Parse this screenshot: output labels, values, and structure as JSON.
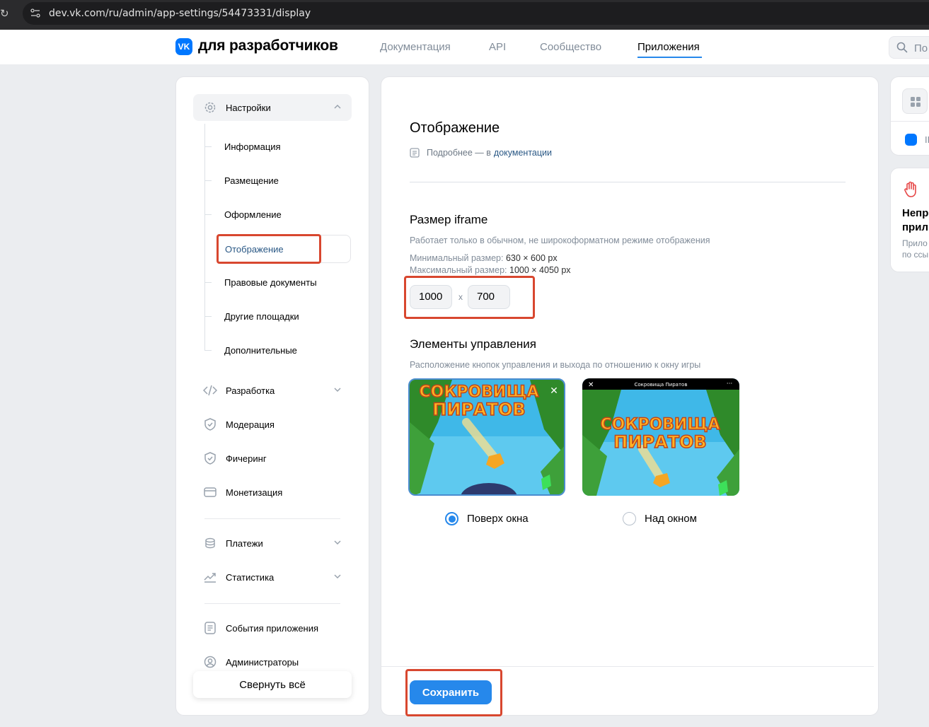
{
  "browser": {
    "url": "dev.vk.com/ru/admin/app-settings/54473331/display"
  },
  "header": {
    "logo_text": "VK",
    "brand": "для разработчиков",
    "nav": [
      "Документация",
      "API",
      "Сообщество",
      "Приложения"
    ],
    "active_nav": "Приложения",
    "search_placeholder": "По"
  },
  "sidebar": {
    "settings_label": "Настройки",
    "sub_items": [
      "Информация",
      "Размещение",
      "Оформление",
      "Отображение",
      "Правовые документы",
      "Другие площадки",
      "Дополнительные"
    ],
    "active_sub": "Отображение",
    "items": [
      "Разработка",
      "Модерация",
      "Фичеринг",
      "Монетизация",
      "Платежи",
      "Статистика",
      "События приложения",
      "Администраторы"
    ],
    "collapse_all": "Свернуть всё"
  },
  "main": {
    "title": "Отображение",
    "doc_prefix": "Подробнее — в",
    "doc_link": "документации",
    "iframe": {
      "title": "Размер iframe",
      "note": "Работает только в обычном, не широкоформатном режиме отображения",
      "min_label": "Минимальный размер:",
      "min_value": "630 × 600 px",
      "max_label": "Максимальный размер:",
      "max_value": "1000 × 4050 px",
      "width": "1000",
      "height": "700",
      "separator": "x"
    },
    "controls": {
      "title": "Элементы управления",
      "note": "Расположение кнопок управления и выхода по отношению к окну игры",
      "game_title_line1": "СОКРОВИЩА",
      "game_title_line2": "ПИРАТОВ",
      "preview_bar_title": "Сокровища Пиратов",
      "option_overlay": "Поверх окна",
      "option_above": "Над окном",
      "selected": "Поверх окна"
    },
    "save_label": "Сохранить"
  },
  "right": {
    "card1_text": "II",
    "card2_title_line1": "Непр",
    "card2_title_line2": "прил",
    "card2_text_line1": "Прило",
    "card2_text_line2": "по ссы"
  },
  "colors": {
    "accent": "#2688eb",
    "link": "#2a5885",
    "highlight": "#d8472f"
  }
}
